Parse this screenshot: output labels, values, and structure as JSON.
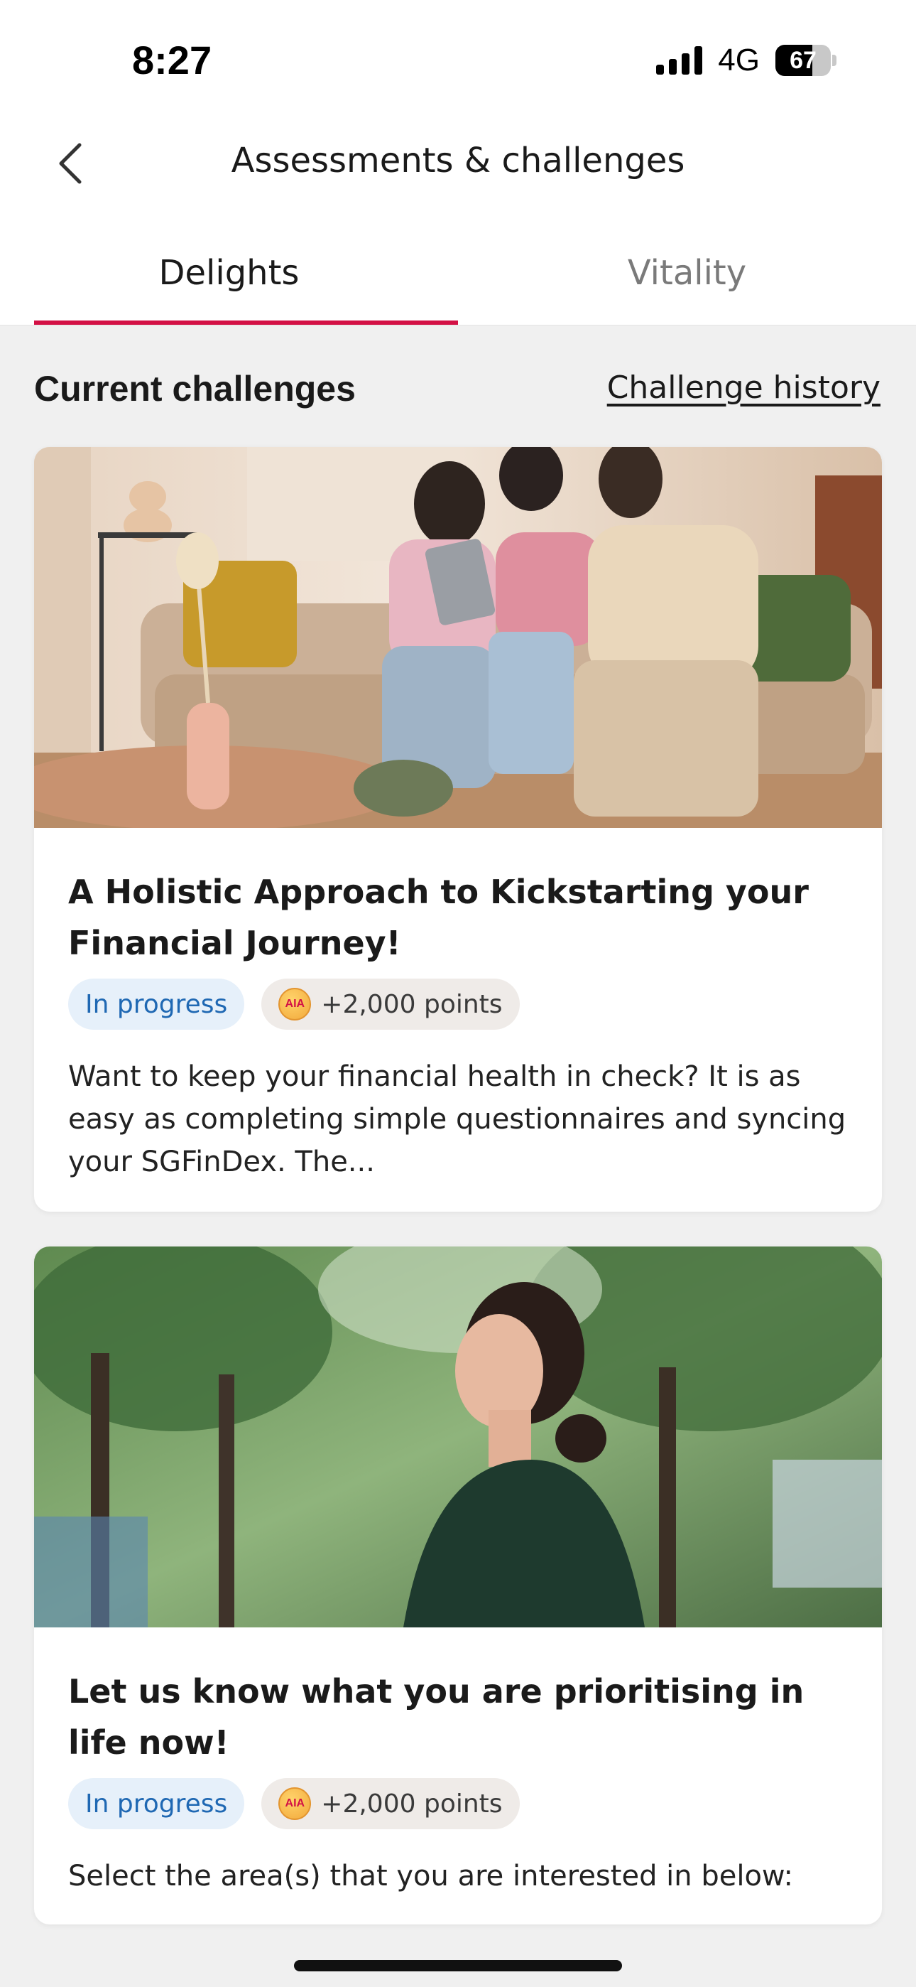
{
  "status_bar": {
    "time": "8:27",
    "network": "4G",
    "battery": "67",
    "battery_level": 0.67
  },
  "header": {
    "title": "Assessments & challenges",
    "back_icon": "chevron-left-icon"
  },
  "tabs": [
    {
      "label": "Delights",
      "active": true
    },
    {
      "label": "Vitality",
      "active": false
    }
  ],
  "section": {
    "title": "Current challenges",
    "history_link": "Challenge history"
  },
  "cards": [
    {
      "title": "A Holistic Approach to Kickstarting your Financial Journey!",
      "status": "In progress",
      "points": "+2,000 points",
      "coin_label": "AIA",
      "description": "Want to keep your financial health in check? It is as easy as completing simple questionnaires and syncing your SGFinDex. The..."
    },
    {
      "title": "Let us know what you are prioritising in life now!",
      "status": "In progress",
      "points": "+2,000 points",
      "coin_label": "AIA",
      "description": "Select the area(s) that you are interested in below:"
    }
  ],
  "colors": {
    "accent": "#d31145",
    "status_badge_bg": "#e6f0fa",
    "status_badge_text": "#1f68b3",
    "background": "#f0f0f0"
  }
}
